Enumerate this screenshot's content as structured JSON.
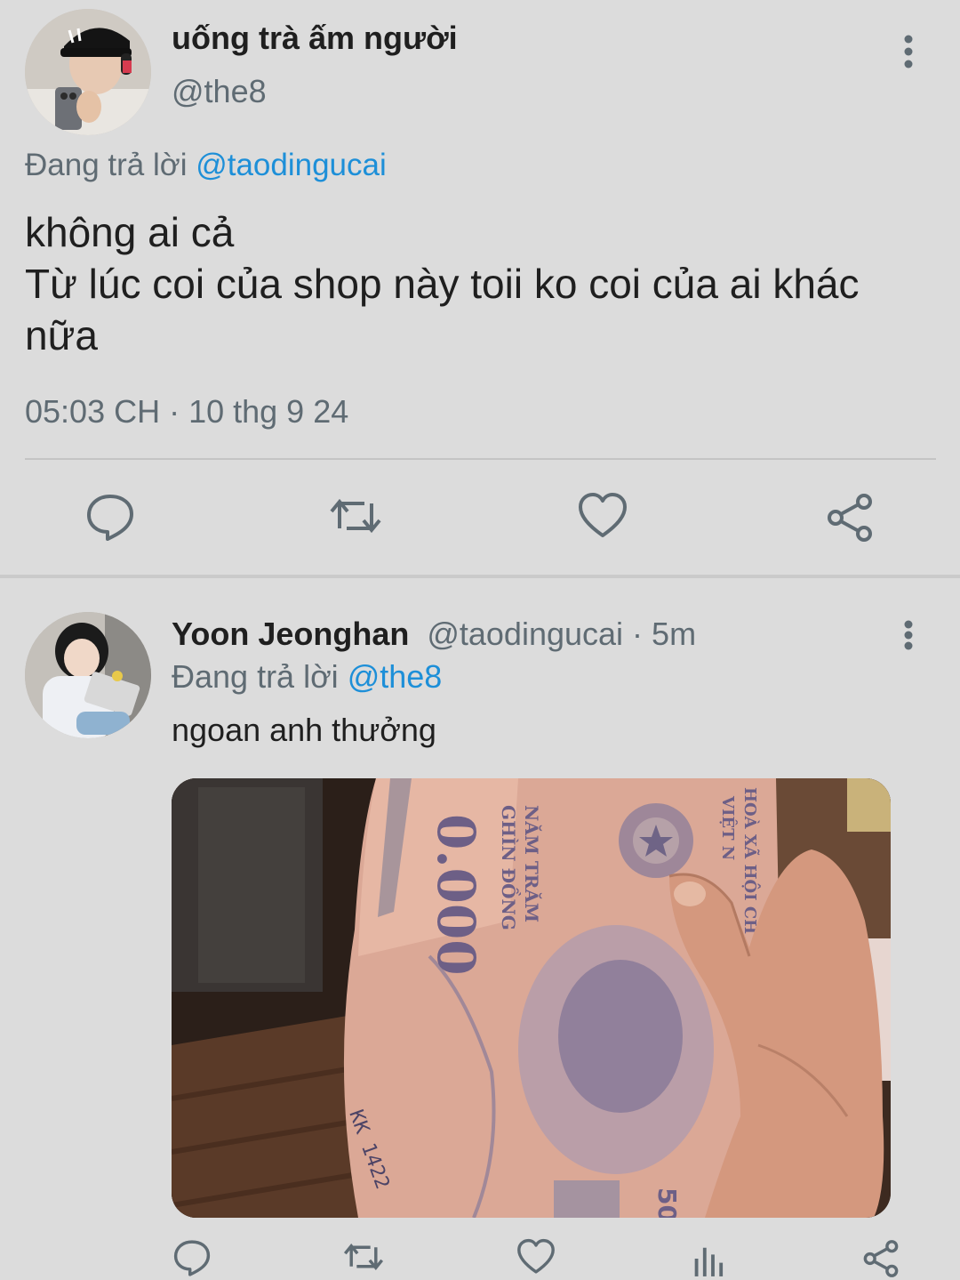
{
  "main_tweet": {
    "author": {
      "display_name": "uống trà ấm người",
      "handle": "@the8",
      "avatar_icon": "avatar-photo"
    },
    "reply_prefix": "Đang trả lời",
    "reply_to": "@taodingucai",
    "text_lines": [
      "không ai cả",
      "Từ lúc coi của shop này toii ko coi của ai khác",
      "nữa"
    ],
    "timestamp": "05:03 CH · 10 thg 9 24",
    "actions": [
      "reply-icon",
      "retweet-icon",
      "like-icon",
      "share-icon"
    ],
    "more_icon": "more-vertical-icon"
  },
  "reply_tweet": {
    "author": {
      "display_name": "Yoon Jeonghan",
      "handle": "@taodingucai",
      "separator": " · ",
      "time": "5m",
      "avatar_icon": "avatar-photo"
    },
    "reply_prefix": "Đang trả lời",
    "reply_to": "@the8",
    "text": "ngoan anh thưởng",
    "media": {
      "kind": "photo",
      "printed_text": {
        "amount": "0.000",
        "denomination_line1": "NĂM TRĂM",
        "denomination_line2": "GHÌN ĐỒNG",
        "country_line1": "HOÀ XÃ HỘI CH",
        "country_line2": "VIỆT N",
        "serial": "KK 1422",
        "corner": "50"
      }
    },
    "actions": [
      "reply-icon",
      "retweet-icon",
      "like-icon",
      "views-icon",
      "share-icon"
    ],
    "more_icon": "more-vertical-icon"
  },
  "colors": {
    "background": "#dcdcdc",
    "text_primary": "#1f1f1f",
    "text_secondary": "#5f6b73",
    "link": "#1d8fd8",
    "icon": "#5f6b73"
  }
}
